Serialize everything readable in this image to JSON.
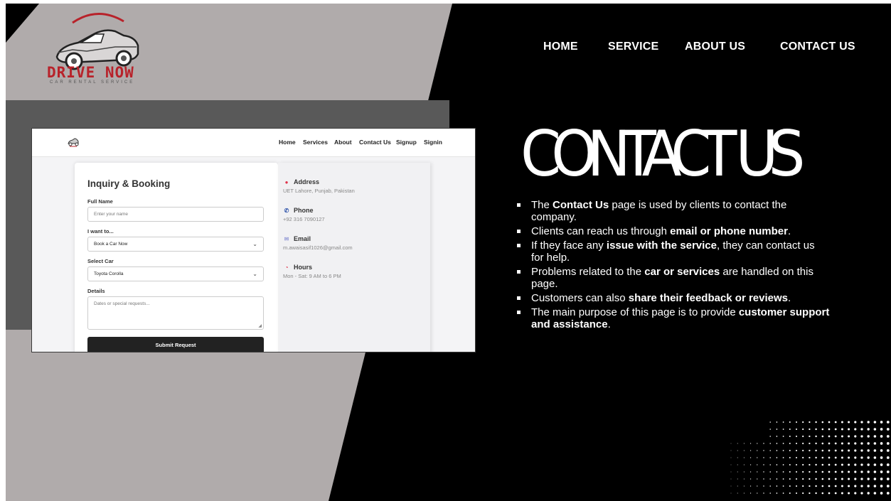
{
  "brand": {
    "name": "DRIVE NOW",
    "tagline": "CAR RENTAL SERVICE"
  },
  "nav": {
    "items": [
      "HOME",
      "SERVICE",
      "ABOUT US",
      "CONTACT US"
    ]
  },
  "slide": {
    "title": "CONTACT US",
    "bullets": [
      {
        "parts": [
          [
            "The ",
            false
          ],
          [
            "Contact Us",
            true
          ],
          [
            " page is used by clients to contact the company.",
            false
          ]
        ]
      },
      {
        "parts": [
          [
            "Clients can reach us through ",
            false
          ],
          [
            "email or phone number",
            true
          ],
          [
            ".",
            false
          ]
        ]
      },
      {
        "parts": [
          [
            "If they face any ",
            false
          ],
          [
            "issue with the service",
            true
          ],
          [
            ", they can contact us for help.",
            false
          ]
        ]
      },
      {
        "parts": [
          [
            "Problems related to the ",
            false
          ],
          [
            "car or services",
            true
          ],
          [
            " are handled on this page.",
            false
          ]
        ]
      },
      {
        "parts": [
          [
            "Customers can also ",
            false
          ],
          [
            "share their feedback or reviews",
            true
          ],
          [
            ".",
            false
          ]
        ]
      },
      {
        "parts": [
          [
            "The main purpose of this page is to provide ",
            false
          ],
          [
            "customer support and assistance",
            true
          ],
          [
            ".",
            false
          ]
        ]
      }
    ]
  },
  "screenshot": {
    "nav": [
      "Home",
      "Services",
      "About",
      "Contact Us",
      "Signup",
      "Signin"
    ],
    "form": {
      "title": "Inquiry & Booking",
      "full_name_label": "Full Name",
      "full_name_placeholder": "Enter your name",
      "intent_label": "I want to...",
      "intent_value": "Book a Car Now",
      "car_label": "Select Car",
      "car_value": "Toyota Corolla",
      "details_label": "Details",
      "details_placeholder": "Dates or special requests...",
      "submit_label": "Submit Request"
    },
    "info": {
      "address_title": "Address",
      "address_value": "UET Lahore, Punjab, Pakistan",
      "phone_title": "Phone",
      "phone_value": "+92 316 7090127",
      "email_title": "Email",
      "email_value": "m.awaisasif1026@gmail.com",
      "hours_title": "Hours",
      "hours_value": "Mon - Sat: 9 AM to 6 PM"
    }
  },
  "colors": {
    "accent_red": "#b8222a",
    "band_grey": "#b0abab",
    "background": "#000000"
  },
  "icons": [
    "car-logo-icon",
    "pin-icon",
    "phone-icon",
    "email-icon",
    "clock-icon",
    "chevron-down-icon"
  ]
}
